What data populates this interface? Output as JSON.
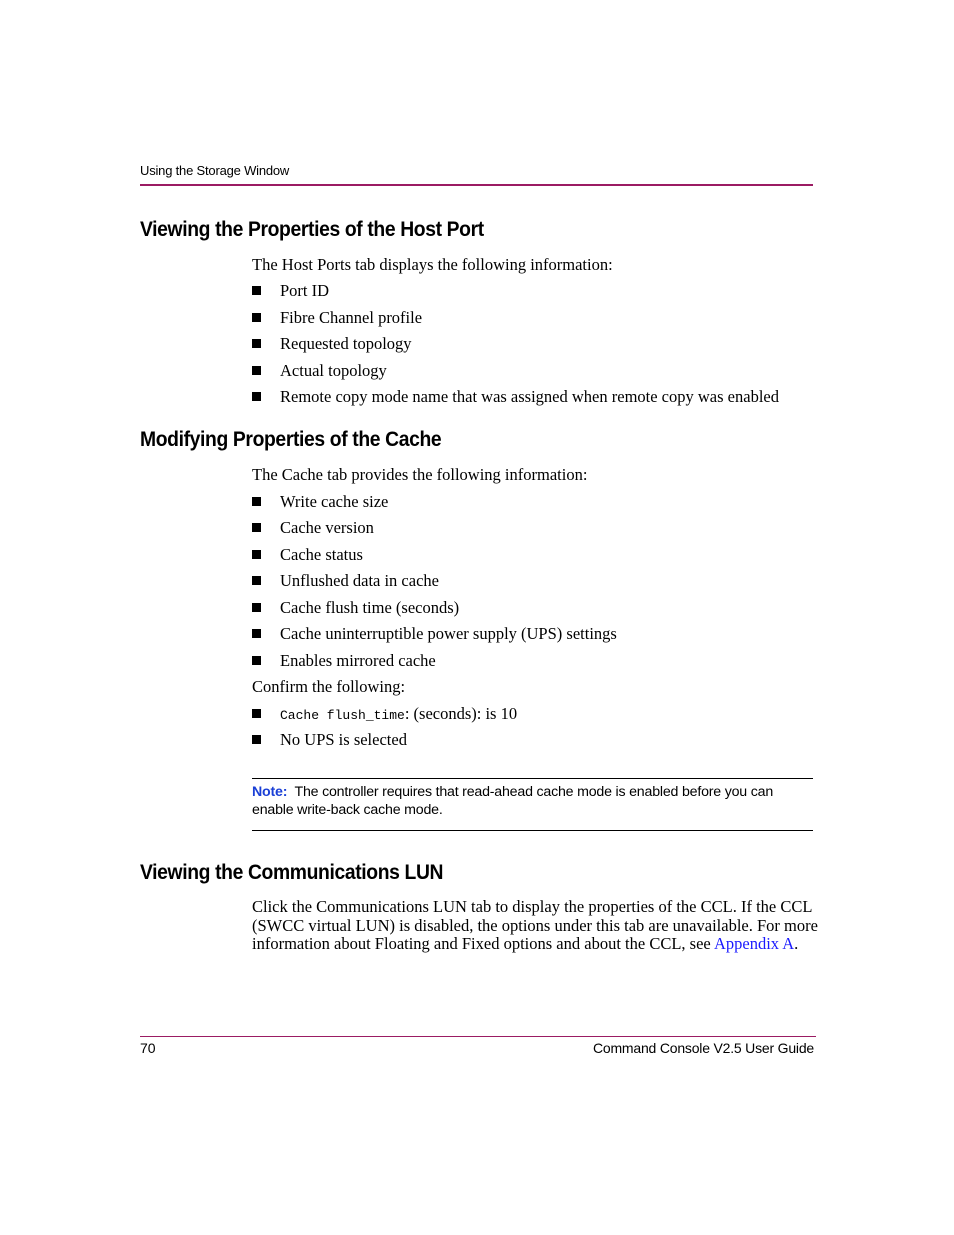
{
  "header": {
    "running_title": "Using the Storage Window"
  },
  "sections": [
    {
      "heading": "Viewing the Properties of the Host Port",
      "intro": "The Host Ports tab displays the following information:",
      "items": [
        "Port ID",
        "Fibre Channel profile",
        "Requested topology",
        "Actual topology",
        "Remote copy mode name that was assigned when remote copy was enabled"
      ]
    },
    {
      "heading": "Modifying Properties of the Cache",
      "intro": "The Cache tab provides the following information:",
      "items": [
        "Write cache size",
        "Cache version",
        "Cache status",
        "Unflushed data in cache",
        "Cache flush time (seconds)",
        "Cache uninterruptible power supply (UPS) settings",
        "Enables mirrored cache"
      ],
      "confirm_intro": "Confirm the following:",
      "confirm_items": [
        {
          "code": "Cache flush_time",
          "text": ": (seconds): is 10"
        },
        {
          "code": "",
          "text": "No UPS is selected"
        }
      ],
      "note": {
        "label": "Note:",
        "text": "The controller requires that read-ahead cache mode is enabled before you can enable write-back cache mode."
      }
    },
    {
      "heading": "Viewing the Communications LUN",
      "paragraph": "Click the Communications LUN tab to display the properties of the CCL. If the CCL (SWCC virtual LUN) is disabled, the options under this tab are unavailable. For more information about Floating and Fixed options and about the CCL, see ",
      "link_text": "Appendix A",
      "paragraph_end": "."
    }
  ],
  "footer": {
    "page_number": "70",
    "book_title": "Command Console V2.5 User Guide"
  },
  "colors": {
    "rule": "#9b1b63",
    "note_label": "#1a3fd6",
    "link": "#1a1aff"
  }
}
